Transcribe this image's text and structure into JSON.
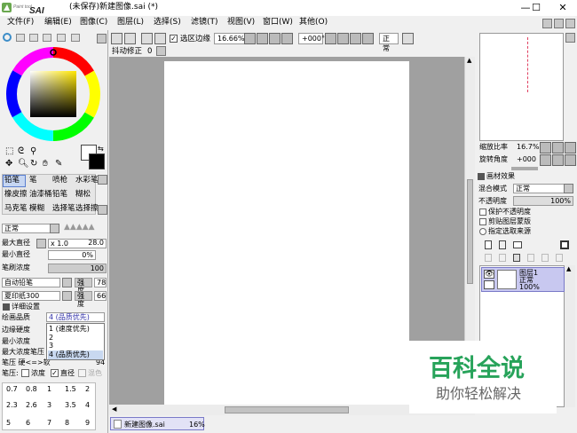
{
  "app": {
    "logo_text": "Paint tool SAI",
    "window_title": "(未保存)新建图像.sai (*)",
    "min_glyph": "—",
    "max_glyph": "☐",
    "close_glyph": "✕"
  },
  "menu": [
    "文件(F)",
    "编辑(E)",
    "图像(C)",
    "图层(L)",
    "选择(S)",
    "滤镜(T)",
    "视图(V)",
    "窗口(W)",
    "其他(O)"
  ],
  "toolbar": {
    "select_edge_label": "选区边缘",
    "zoom": "16.66%",
    "rotation": "+000°",
    "blend_mode": "正常",
    "stabilizer_label": "抖动修正",
    "stabilizer_value": "0"
  },
  "tools": {
    "row1": [
      "铅笔",
      "笔",
      "喷枪",
      "水彩笔"
    ],
    "row2": [
      "橡皮擦",
      "油漆桶",
      "铅笔",
      "糊松"
    ],
    "row3": [
      "马克笔",
      "模糊",
      "选择笔",
      "选择擦"
    ]
  },
  "brush": {
    "mode": "正常",
    "max_diameter_label": "最大直径",
    "max_diameter_mult": "x 1.0",
    "max_diameter_value": "28.0",
    "min_diameter_label": "最小直径",
    "min_diameter_value": "0%",
    "density_label": "笔刷浓度",
    "density_value": "100",
    "shape_value": "自动铅笔",
    "shape_strength_label": "强度",
    "shape_strength_value": "78",
    "texture_value": "夏印纸300",
    "texture_strength_label": "强度",
    "texture_strength_value": "66"
  },
  "details": {
    "header": "详细设置",
    "quality_label": "绘画品质",
    "quality_value": "4 (品质优先)",
    "edge_label": "边缘硬度",
    "min_density_label": "最小浓度",
    "max_pressure_label": "最大浓度笔压",
    "pressure_hard_label": "笔压 硬<=>软",
    "pressure_hard_value": "94",
    "pressure_row_label": "笔压:",
    "pressure_density": "浓度",
    "pressure_diameter": "直径",
    "pressure_blend": "混色",
    "dropdown_options": [
      "1 (速度优先)",
      "2",
      "3",
      "4 (品质优先)"
    ]
  },
  "size_presets": {
    "row1": [
      "0.7",
      "0.8",
      "1",
      "1.5",
      "2"
    ],
    "row2": [
      "2.3",
      "2.6",
      "3",
      "3.5",
      "4"
    ],
    "row3": [
      "5",
      "6",
      "7",
      "8",
      "9"
    ]
  },
  "navigator": {
    "zoom_label": "缩放比率",
    "zoom_value": "16.7%",
    "angle_label": "旋转角度",
    "angle_value": "+000"
  },
  "layer_effects": {
    "header": "画材效果",
    "blend_label": "混合模式",
    "blend_value": "正常",
    "opacity_label": "不透明度",
    "opacity_value": "100%",
    "options": [
      "保护不透明度",
      "剪贴图层蒙版",
      "指定选取来源"
    ]
  },
  "layers": [
    {
      "name": "图层1",
      "mode": "正常",
      "opacity": "100%"
    }
  ],
  "doc_tab": {
    "name": "新建图像.sai",
    "zoom": "16%"
  },
  "watermark": {
    "title": "百科全说",
    "subtitle": "助你轻松解决"
  },
  "colors": {
    "accent": "#3c8dc8",
    "watermark_green": "#27a35a",
    "layer_selected": "#c8c8f0",
    "canvas_bg": "#a0a0a0"
  }
}
